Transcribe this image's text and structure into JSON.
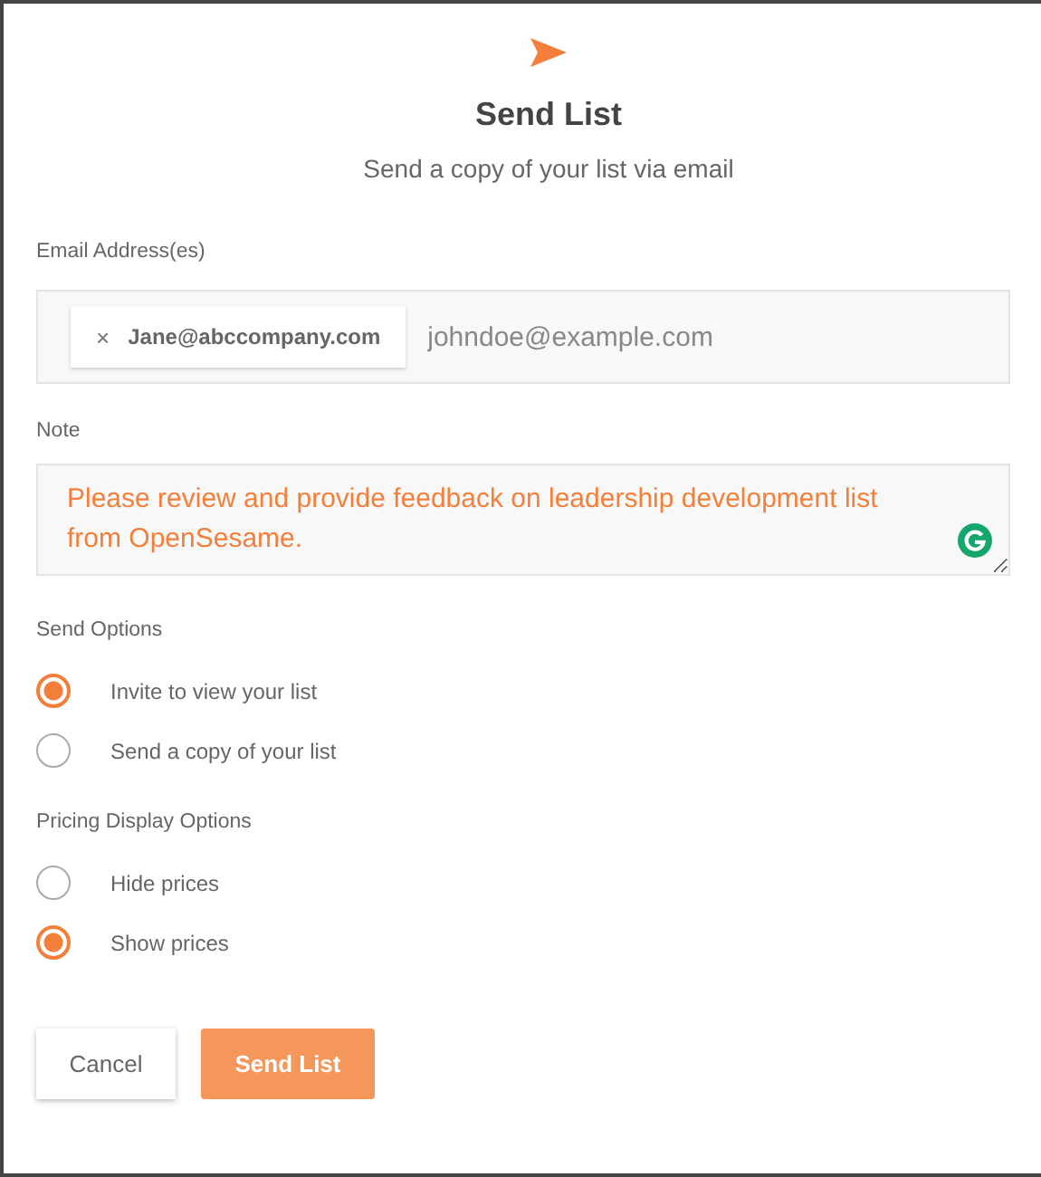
{
  "dialog": {
    "title": "Send List",
    "subtitle": "Send a copy of your list via email"
  },
  "email": {
    "label": "Email Address(es)",
    "chips": [
      {
        "remove": "×",
        "address": "Jane@abccompany.com"
      }
    ],
    "placeholder": "johndoe@example.com"
  },
  "note": {
    "label": "Note",
    "value": "Please review and provide feedback on leadership development list from OpenSesame."
  },
  "option_groups": [
    {
      "label": "Send Options",
      "options": [
        {
          "label": "Invite to view your list",
          "selected": true
        },
        {
          "label": "Send a copy of your list",
          "selected": false
        }
      ]
    },
    {
      "label": "Pricing Display Options",
      "options": [
        {
          "label": "Hide prices",
          "selected": false
        },
        {
          "label": "Show prices",
          "selected": true
        }
      ]
    }
  ],
  "buttons": [
    {
      "label": "Cancel",
      "kind": "secondary"
    },
    {
      "label": "Send List",
      "kind": "primary"
    }
  ]
}
